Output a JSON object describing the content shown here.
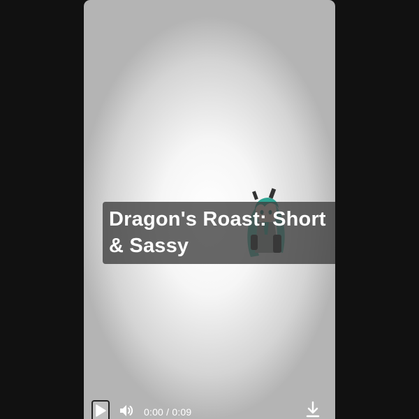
{
  "video": {
    "title": "Dragon's Roast: Short & Sassy",
    "current_time": "0:00",
    "duration": "0:09",
    "time_separator": " / "
  },
  "controls": {
    "play_icon": "play-icon",
    "volume_icon": "volume-icon",
    "download_icon": "download-icon"
  },
  "colors": {
    "page_background": "#111111",
    "title_box": "#3c3c3c",
    "control_text": "#ffffff",
    "character_hair": "#3fb8a6"
  }
}
